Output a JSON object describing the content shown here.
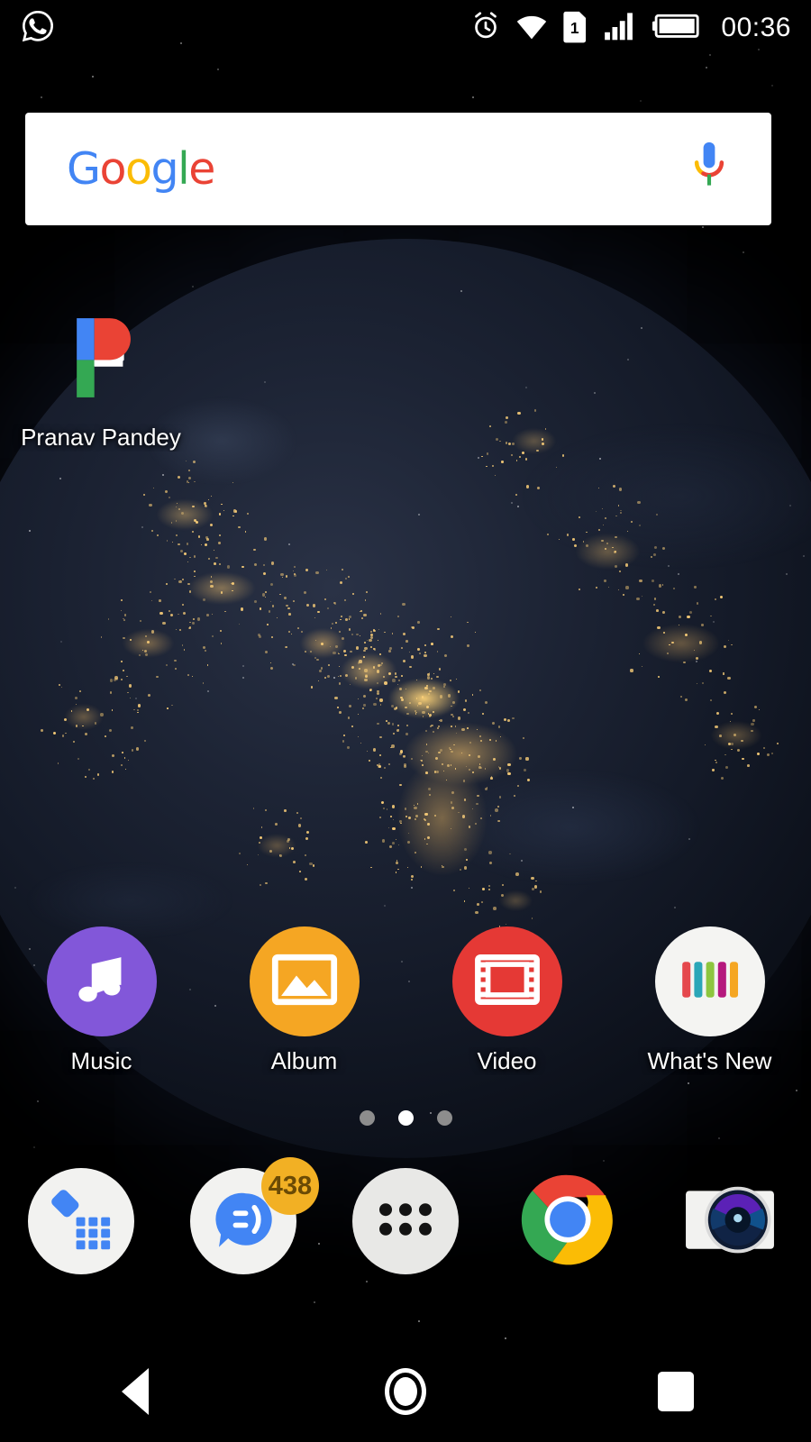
{
  "status_bar": {
    "notification_icons": [
      {
        "name": "whatsapp-icon",
        "label": "WhatsApp"
      }
    ],
    "system_icons": [
      {
        "name": "alarm-icon",
        "label": "Alarm"
      },
      {
        "name": "wifi-icon",
        "label": "Wi-Fi"
      },
      {
        "name": "sim-icon",
        "label": "SIM 1"
      },
      {
        "name": "signal-icon",
        "label": "Signal"
      },
      {
        "name": "battery-icon",
        "label": "Battery full"
      }
    ],
    "sim_number": "1",
    "clock": "00:36"
  },
  "search_widget": {
    "logo_letters": [
      {
        "char": "G",
        "color": "#4285F4"
      },
      {
        "char": "o",
        "color": "#EA4335"
      },
      {
        "char": "o",
        "color": "#FBBC05"
      },
      {
        "char": "g",
        "color": "#4285F4"
      },
      {
        "char": "l",
        "color": "#34A853"
      },
      {
        "char": "e",
        "color": "#EA4335"
      }
    ],
    "logo_text": "Google",
    "mic_label": "Voice search",
    "background": "#FFFFFF"
  },
  "home_shortcuts": [
    {
      "name": "pranav-pandey",
      "label": "Pranav Pandey",
      "icon": "p-letter-icon",
      "colors": {
        "blue": "#4285F4",
        "red": "#EA4335",
        "green": "#34A853",
        "white": "#FFFFFF"
      }
    }
  ],
  "app_row": [
    {
      "name": "music",
      "label": "Music",
      "icon": "music-note-icon",
      "bg": "#8257D9",
      "fg": "#FFFFFF"
    },
    {
      "name": "album",
      "label": "Album",
      "icon": "photo-icon",
      "bg": "#F5A623",
      "fg": "#FFFFFF"
    },
    {
      "name": "video",
      "label": "Video",
      "icon": "film-strip-icon",
      "bg": "#E53935",
      "fg": "#FFFFFF"
    },
    {
      "name": "whats-new",
      "label": "What's New",
      "icon": "bars-icon",
      "bg": "#F4F4F2",
      "bar_colors": [
        "#E5484D",
        "#2BA6B8",
        "#8DC63F",
        "#B5197D",
        "#F5A623"
      ]
    }
  ],
  "page_indicator": {
    "total": 3,
    "active_index": 1,
    "dot_color": "#8D8D8D",
    "active_color": "#FFFFFF"
  },
  "dock": [
    {
      "name": "phone",
      "label": "Phone",
      "icon": "phone-dialpad-icon",
      "bg": "#F2F2F0",
      "fg": "#4285F4"
    },
    {
      "name": "messaging",
      "label": "Messaging",
      "icon": "chat-bubble-icon",
      "bg": "#F2F2F0",
      "fg": "#4285F4",
      "badge": "438",
      "badge_bg": "#F2B024",
      "badge_fg": "#6B4A05"
    },
    {
      "name": "app-drawer",
      "label": "Apps",
      "icon": "app-grid-icon",
      "bg": "#E8E8E6",
      "fg": "#111111"
    },
    {
      "name": "chrome",
      "label": "Chrome",
      "icon": "chrome-icon",
      "colors": {
        "red": "#EA4335",
        "yellow": "#FBBC05",
        "green": "#34A853",
        "blue": "#4285F4"
      }
    },
    {
      "name": "camera",
      "label": "Camera",
      "icon": "camera-lens-icon",
      "bg": "#F2F2F0",
      "lens": "#1B2B4A"
    }
  ],
  "nav_bar": [
    {
      "name": "back-button",
      "label": "Back",
      "icon": "triangle-back-icon"
    },
    {
      "name": "home-button",
      "label": "Home",
      "icon": "circle-home-icon"
    },
    {
      "name": "recents-button",
      "label": "Recents",
      "icon": "square-recents-icon"
    }
  ],
  "wallpaper": {
    "name": "earth-at-night-wallpaper",
    "description": "Earth at night",
    "base_color": "#05070C",
    "light_color": "#FFD27A"
  }
}
